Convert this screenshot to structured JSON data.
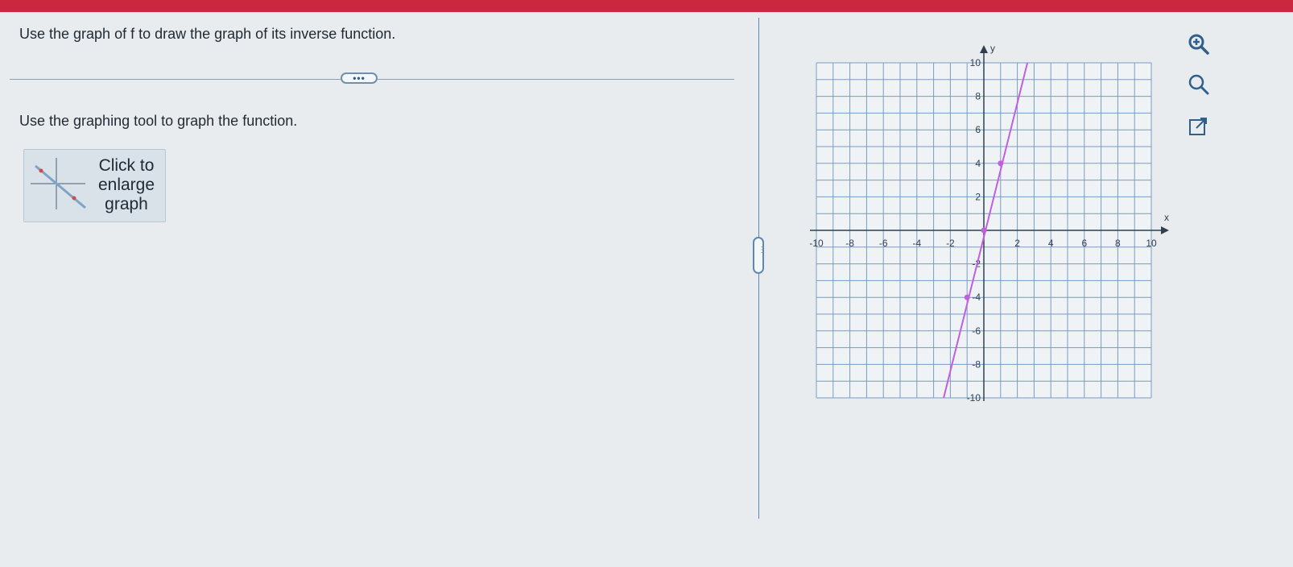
{
  "question": {
    "text": "Use the graph of f to draw the graph of its inverse function."
  },
  "more_button": {
    "label": "•••"
  },
  "instruction": {
    "text": "Use the graphing tool to graph the function."
  },
  "enlarge_button": {
    "line1": "Click to",
    "line2": "enlarge",
    "line3": "graph"
  },
  "tools": {
    "zoom_in_icon": "zoom-in-icon",
    "zoom_out_icon": "zoom-out-icon",
    "popout_icon": "external-link-icon"
  },
  "colors": {
    "accent_bar": "#c9283e",
    "line": "#c060e0",
    "grid": "#7a9cc0",
    "axis": "#2f3f50"
  },
  "chart_data": {
    "type": "line",
    "xlabel": "x",
    "ylabel": "y",
    "xlim": [
      -10,
      10
    ],
    "ylim": [
      -10,
      10
    ],
    "grid": true,
    "minor_step": 1,
    "x_tick_labels": [
      "-10",
      "-8",
      "-6",
      "-4",
      "-2",
      "2",
      "4",
      "6",
      "8",
      "10"
    ],
    "y_tick_labels": [
      "10",
      "8",
      "6",
      "4",
      "2",
      "-2",
      "-4",
      "-6",
      "-8",
      "-10"
    ],
    "series": [
      {
        "points": [
          [
            -2.4,
            -10
          ],
          [
            2.6,
            10
          ]
        ],
        "marked_points": [
          [
            -1,
            -4
          ],
          [
            0,
            0
          ],
          [
            1,
            4
          ]
        ]
      }
    ]
  }
}
